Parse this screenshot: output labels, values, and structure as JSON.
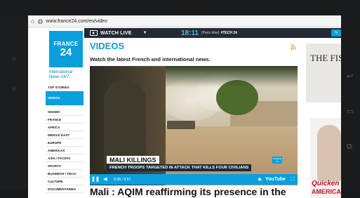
{
  "browser": {
    "url": "www.france24.com/en/video"
  },
  "topbar": {
    "watch_live": "WATCH LIVE",
    "time": "18:11",
    "time_zone": "(Paris time)",
    "hashtag": "#TECH 24",
    "button": "N"
  },
  "brand": {
    "logo_line1": "FRANCE",
    "logo_line2": "24",
    "tagline": "International News 24/7",
    "color": "#0b9fdd"
  },
  "sidebar": {
    "items": [
      {
        "label": "TOP STORIES"
      },
      {
        "label": "VIDEOS",
        "active": true
      },
      {
        "label": "SHOWS"
      },
      {
        "label": "FRANCE"
      },
      {
        "label": "AFRICA"
      },
      {
        "label": "MIDDLE EAST"
      },
      {
        "label": "EUROPE"
      },
      {
        "label": "AMERICAS"
      },
      {
        "label": "ASIA / PACIFIC"
      },
      {
        "label": "SPORTS"
      },
      {
        "label": "BUSINESS / TECH"
      },
      {
        "label": "CULTURE"
      },
      {
        "label": "DOCUMENTARIES"
      }
    ]
  },
  "main": {
    "title": "VIDEOS",
    "subtitle": "Watch the latest French and international news.",
    "video": {
      "caption_title": "MALI KILLINGS",
      "caption_sub": "FRENCH TROOPS TARGETED IN ATTACK THAT KILLS FOUR CIVILIANS",
      "badge": "FRANCE 24",
      "time": "0:35 / 5:57",
      "youtube": "YouTube"
    },
    "headline": "Mali : AQIM reaffirming its presence in the"
  },
  "ads": {
    "ad1_text": "THE FISH AND THE",
    "ad2_text1": "Quicken",
    "ad2_text2": "AMERICA"
  }
}
